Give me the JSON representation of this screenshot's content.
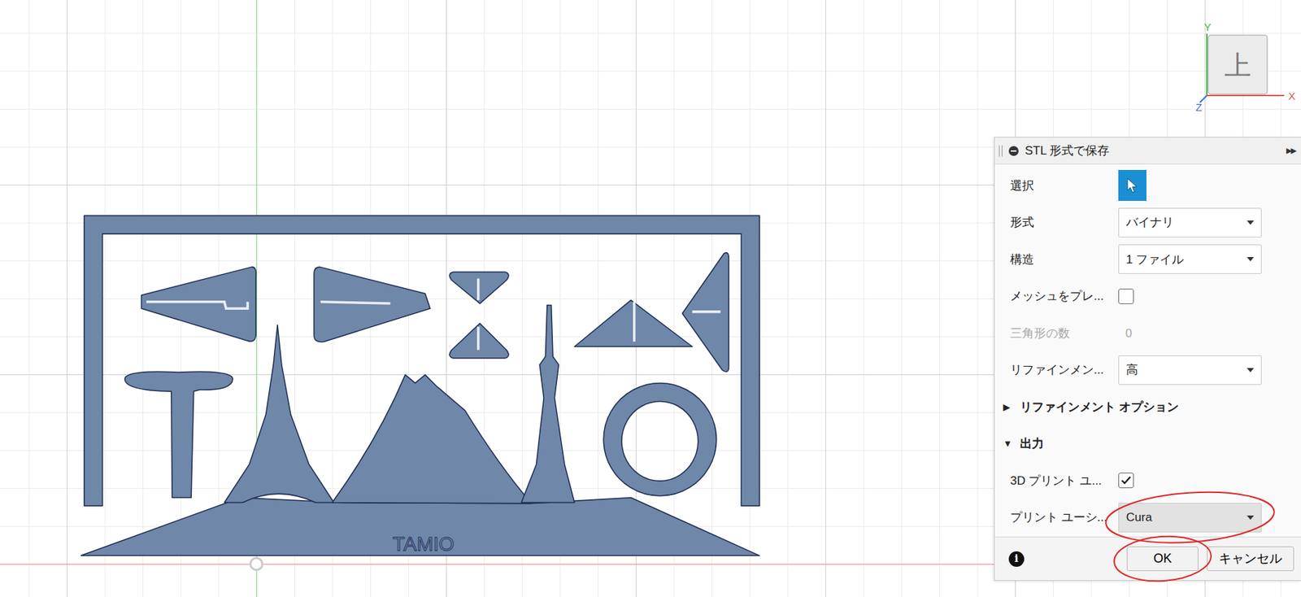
{
  "viewcube": {
    "face": "上",
    "axes": [
      {
        "label": "Y",
        "color": "#46b446"
      },
      {
        "label": "X",
        "color": "#e25555"
      },
      {
        "label": "Z",
        "color": "#3f6fd6"
      }
    ]
  },
  "design": {
    "label": "TAMIO",
    "selected": true
  },
  "dialog": {
    "title": "STL 形式で保存",
    "expand_icon": "▶▶",
    "rows": [
      {
        "kind": "select",
        "label": "選択",
        "selected": true
      },
      {
        "kind": "dropdown",
        "label": "形式",
        "value": "バイナリ",
        "highlighted": false,
        "annotated": false
      },
      {
        "kind": "dropdown",
        "label": "構造",
        "value": "1 ファイル",
        "highlighted": false,
        "annotated": false
      },
      {
        "kind": "checkbox",
        "label": "メッシュをプレ...",
        "checked": false
      },
      {
        "kind": "readonly",
        "label": "三角形の数",
        "value": "0",
        "disabled": true
      },
      {
        "kind": "dropdown",
        "label": "リファインメン...",
        "value": "高",
        "highlighted": false,
        "annotated": false
      },
      {
        "kind": "section",
        "label": "リファインメント オプション",
        "icon": "▶",
        "expanded": false
      },
      {
        "kind": "section",
        "label": "出力",
        "icon": "▼",
        "expanded": true
      },
      {
        "kind": "checkbox",
        "label": "3D プリント ユ...",
        "checked": true
      },
      {
        "kind": "dropdown",
        "label": "プリント ユーシ...",
        "value": "Cura",
        "highlighted": true,
        "annotated": true
      }
    ],
    "info_icon": "i",
    "buttons": [
      {
        "label": "OK",
        "annotated": true
      },
      {
        "label": "キャンセル",
        "annotated": false
      }
    ]
  }
}
